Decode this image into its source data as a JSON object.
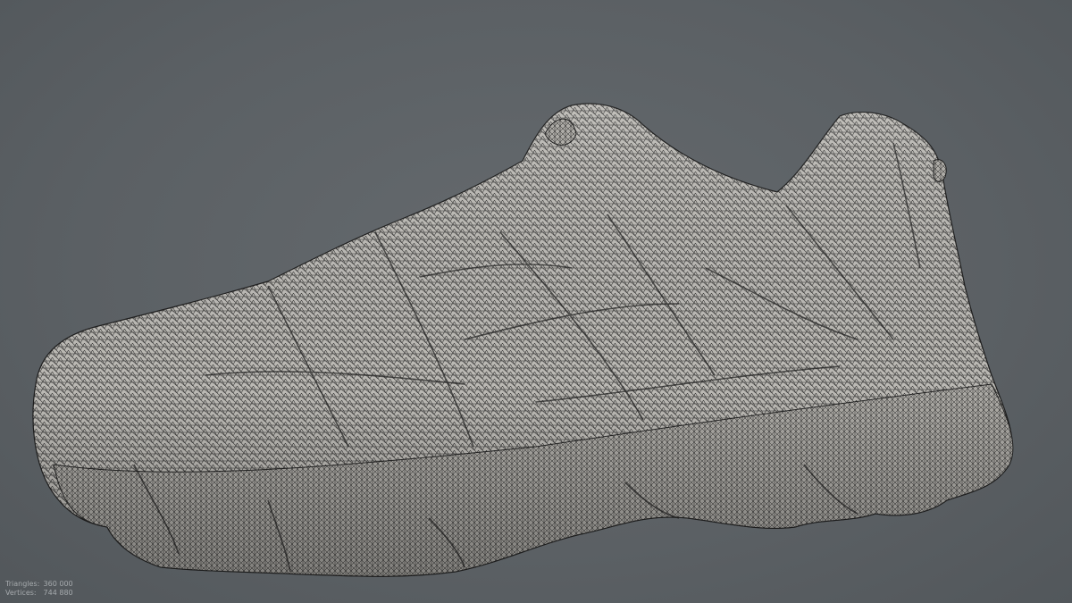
{
  "viewport": {
    "background_color": "#5d6266",
    "model_fill_color": "#b9b7b2",
    "wire_color": "#2a2a2a",
    "subject": "shoe-mesh-icon"
  },
  "stats": {
    "triangles_label": "Triangles:",
    "triangles_value": "360 000",
    "vertices_label": "Vertices:",
    "vertices_value": "744 880"
  }
}
